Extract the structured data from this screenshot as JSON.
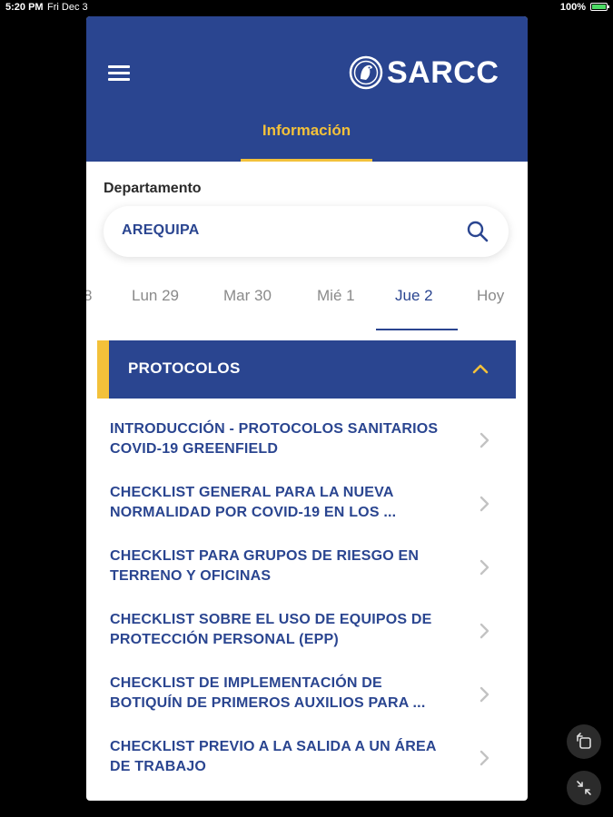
{
  "status_bar": {
    "time": "5:20 PM",
    "date": "Fri Dec 3",
    "battery": "100%"
  },
  "header": {
    "menu_icon": "hamburger-icon",
    "logo_text": "SARCC",
    "tab_label": "Información"
  },
  "department": {
    "label": "Departamento",
    "value": "AREQUIPA",
    "search_icon": "search-icon"
  },
  "date_tabs": [
    {
      "label": "8"
    },
    {
      "label": "Lun 29"
    },
    {
      "label": "Mar 30"
    },
    {
      "label": "Mié 1"
    },
    {
      "label": "Jue 2"
    },
    {
      "label": "Hoy"
    }
  ],
  "active_date_index": 4,
  "section": {
    "title": "PROTOCOLOS",
    "expanded": true
  },
  "items": [
    {
      "line1": "INTRODUCCIÓN - PROTOCOLOS SANITARIOS",
      "line2": "COVID-19 GREENFIELD"
    },
    {
      "line1": "CHECKLIST GENERAL PARA LA NUEVA",
      "line2": "NORMALIDAD POR COVID-19 EN LOS ..."
    },
    {
      "line1": "CHECKLIST PARA GRUPOS DE RIESGO EN",
      "line2": "TERRENO Y OFICINAS"
    },
    {
      "line1": "CHECKLIST SOBRE EL USO DE EQUIPOS DE",
      "line2": "PROTECCIÓN PERSONAL (EPP)"
    },
    {
      "line1": "CHECKLIST DE IMPLEMENTACIÓN DE",
      "line2": "BOTIQUÍN DE PRIMEROS AUXILIOS PARA ..."
    },
    {
      "line1": "CHECKLIST PREVIO A LA SALIDA A UN ÁREA",
      "line2": "DE TRABAJO"
    }
  ],
  "colors": {
    "primary": "#2a4590",
    "accent": "#f3c13a",
    "text_muted": "#8a8a8a"
  }
}
